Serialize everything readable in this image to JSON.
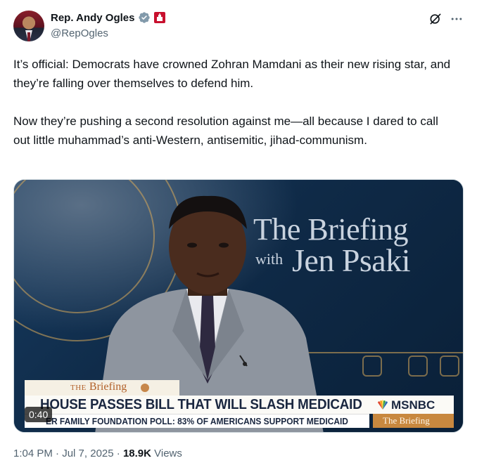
{
  "author": {
    "name": "Rep. Andy Ogles",
    "handle": "@RepOgles"
  },
  "icons": {
    "verified": "verified-badge-icon",
    "affiliation": "us-house-flag-icon",
    "grok": "grok-icon",
    "more": "more-options-icon"
  },
  "tweet": {
    "text": "It’s official: Democrats have crowned Zohran Mamdani as their new rising star, and they’re falling over themselves to defend him.\n\nNow they’re pushing a second resolution against me—all because I dared to call out little muhammad’s anti-Western, antisemitic, jihad-communism."
  },
  "media": {
    "show_title_line1": "The Briefing",
    "show_title_with": "with",
    "show_title_host": "Jen Psaki",
    "brand_small": "THE",
    "brand_large": "Briefing",
    "headline": "HOUSE PASSES BILL THAT WILL SLASH MEDICAID",
    "ticker": "ER FAMILY FOUNDATION POLL: 83% OF AMERICANS SUPPORT MEDICAID",
    "network": "MSNBC",
    "network_sub": "The Briefing",
    "duration": "0:40"
  },
  "meta": {
    "time": "1:04 PM",
    "sep1": " · ",
    "date": "Jul 7, 2025",
    "sep2": " · ",
    "views_count": "18.9K",
    "views_label": " Views"
  },
  "colors": {
    "text_primary": "#0f1419",
    "text_secondary": "#536471",
    "verified_blue": "#829aab",
    "flag_red": "#c8102e"
  }
}
